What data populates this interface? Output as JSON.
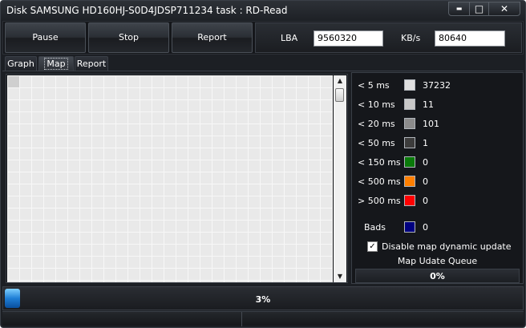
{
  "window": {
    "title": "Disk SAMSUNG HD160HJ-S0D4JDSP711234   task : RD-Read",
    "controls": {
      "minimize": "▬",
      "maximize": "□",
      "close": "✕"
    }
  },
  "toolbar": {
    "pause_label": "Pause",
    "stop_label": "Stop",
    "report_label": "Report",
    "lba_label": "LBA",
    "lba_value": "9560320",
    "kbs_label": "KB/s",
    "kbs_value": "80640"
  },
  "tabs": [
    {
      "label": "Graph",
      "active": false
    },
    {
      "label": "Map",
      "active": true
    },
    {
      "label": "Report",
      "active": false
    }
  ],
  "legend": {
    "items": [
      {
        "label": "< 5 ms",
        "color": "#e0e0e0",
        "count": "37232"
      },
      {
        "label": "< 10 ms",
        "color": "#c8c8c8",
        "count": "11"
      },
      {
        "label": "< 20 ms",
        "color": "#8c8c8c",
        "count": "101"
      },
      {
        "label": "< 50 ms",
        "color": "#3c3c3c",
        "count": "1"
      },
      {
        "label": "< 150 ms",
        "color": "#0a7a0a",
        "count": "0"
      },
      {
        "label": "< 500 ms",
        "color": "#ff7f00",
        "count": "0"
      },
      {
        "label": "> 500 ms",
        "color": "#ff0000",
        "count": "0"
      }
    ],
    "bads": {
      "label": "Bads",
      "color": "#000080",
      "count": "0"
    },
    "dynamic_update": {
      "label": "Disable map dynamic update",
      "checked": true,
      "check_glyph": "✓"
    },
    "queue_title": "Map Udate Queue",
    "queue_value": "0%",
    "queue_fraction": 0
  },
  "progress": {
    "text": "3%",
    "fraction": 0.03
  },
  "scrollbar": {
    "up_glyph": "▲",
    "down_glyph": "▼"
  }
}
